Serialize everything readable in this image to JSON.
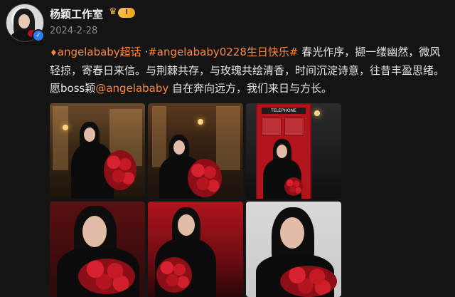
{
  "post": {
    "author": "杨颖工作室",
    "level_badge": "I",
    "date": "2024-2-28",
    "supertopic": "angelababy超话",
    "hashtag": "#angelababy0228生日快乐#",
    "text_main": " 春光作序，撷一缕幽然，微风轻掠，寄春日来信。与荆棘共存，与玫瑰共绘清香，时间沉淀诗意，往昔丰盈思绪。愿boss颖",
    "mention": "@angelababy",
    "text_end": " 自在奔向远方，我们来日与方长。"
  },
  "photo_signs": {
    "telephone": "TELEPHONE"
  },
  "icons": {
    "verified": "verified-check-icon",
    "crown": "crown-icon",
    "supertopic": "diamond-icon"
  },
  "colors": {
    "background": "#141414",
    "link": "#ff8a3d",
    "badge_gold": "#f6c453",
    "verified_blue": "#2f7ef5"
  }
}
